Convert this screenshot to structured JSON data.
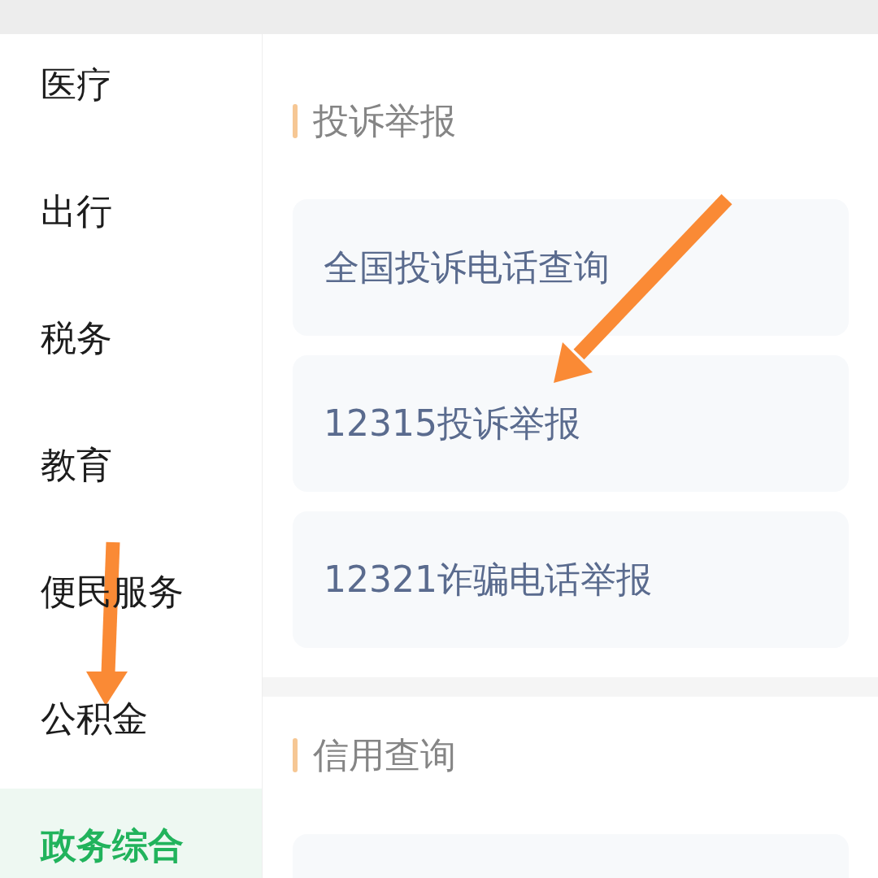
{
  "sidebar": {
    "items": [
      {
        "label": "医疗",
        "selected": false
      },
      {
        "label": "出行",
        "selected": false
      },
      {
        "label": "税务",
        "selected": false
      },
      {
        "label": "教育",
        "selected": false
      },
      {
        "label": "便民服务",
        "selected": false
      },
      {
        "label": "公积金",
        "selected": false
      },
      {
        "label": "政务综合",
        "selected": true
      }
    ]
  },
  "content": {
    "sections": [
      {
        "title": "投诉举报",
        "items": [
          "全国投诉电话查询",
          "12315投诉举报",
          "12321诈骗电话举报"
        ]
      },
      {
        "title": "信用查询",
        "clipped_card": true
      }
    ]
  }
}
